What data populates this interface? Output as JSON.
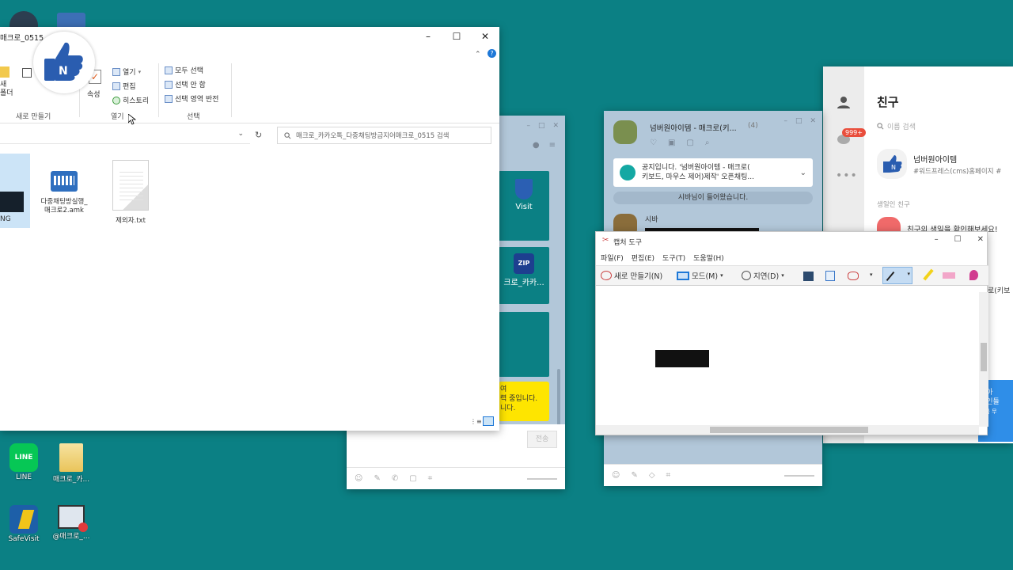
{
  "desktop": {
    "icons": [
      {
        "label": "LINE",
        "icon": "line-app-icon"
      },
      {
        "label": "매크로_카...",
        "icon": "folder-icon"
      },
      {
        "label": "SafeVisit",
        "icon": "safevisit-icon"
      },
      {
        "label": "@매크로_...",
        "icon": "macro-app-icon"
      }
    ]
  },
  "explorer": {
    "title": "매크로_0515",
    "ribbon": {
      "new_group_label": "새로 만들기",
      "new_folder_label": "새\n폴더",
      "open_group_label": "열기",
      "open_label": "열기",
      "edit_label": "편집",
      "history_label": "히스토리",
      "properties_label": "속성",
      "select_group_label": "선택",
      "select_all_label": "모두 선택",
      "select_none_label": "선택 안 함",
      "invert_selection_label": "선택 영역 반전"
    },
    "search_placeholder": "매크로_카카오톡_다중채팅방금지어매크로_0515 검색",
    "files": [
      {
        "name": "NG",
        "icon": "image-file-icon"
      },
      {
        "name": "다중채팅방실행_\n매크로2.amk",
        "icon": "macro-file-icon"
      },
      {
        "name": "제외자.txt",
        "icon": "text-file-icon"
      }
    ]
  },
  "kakao_chat_1": {
    "tiles": [
      {
        "label": "Visit"
      },
      {
        "label": "ZIP"
      },
      {
        "label": "크로_카카..."
      }
    ],
    "notice_lines": [
      "여",
      "력 중입니다.",
      "니다."
    ],
    "send_label": "전송"
  },
  "kakao_chat_2": {
    "title": "넘버원아이템 - 매크로(키...",
    "member_count": "(4)",
    "notice_text": "공지입니다. '넘버원아이템 - 매크로(\n키보드, 마우스 제어)제작' 오픈채팅...",
    "system_message": "시바님이 들어왔습니다.",
    "sender_name": "시바"
  },
  "snipping_tool": {
    "title": "캡처 도구",
    "menu": [
      "파일(F)",
      "편집(E)",
      "도구(T)",
      "도움말(H)"
    ],
    "new_label": "새로 만들기(N)",
    "mode_label": "모드(M)",
    "delay_label": "지연(D)"
  },
  "friends": {
    "title": "친구",
    "search_placeholder": "이름 검색",
    "badge": "999+",
    "profile_name": "넘버원아이템",
    "profile_status": "#워드프레스(cms)홈페이지 #",
    "birthday_header": "생일인 친구",
    "birthday_text": "친구의 생일을 확인해보세요!",
    "right_snippet": "로(키보",
    "side_text_1": "알아",
    "side_text_2": "장인들",
    "side_text_3": "지금 무"
  },
  "colors": {
    "desktop": "#0b8084",
    "kakao_bg": "#b2c7d9",
    "kakao_yellow": "#fee500",
    "explorer_accent": "#1e78d7"
  }
}
